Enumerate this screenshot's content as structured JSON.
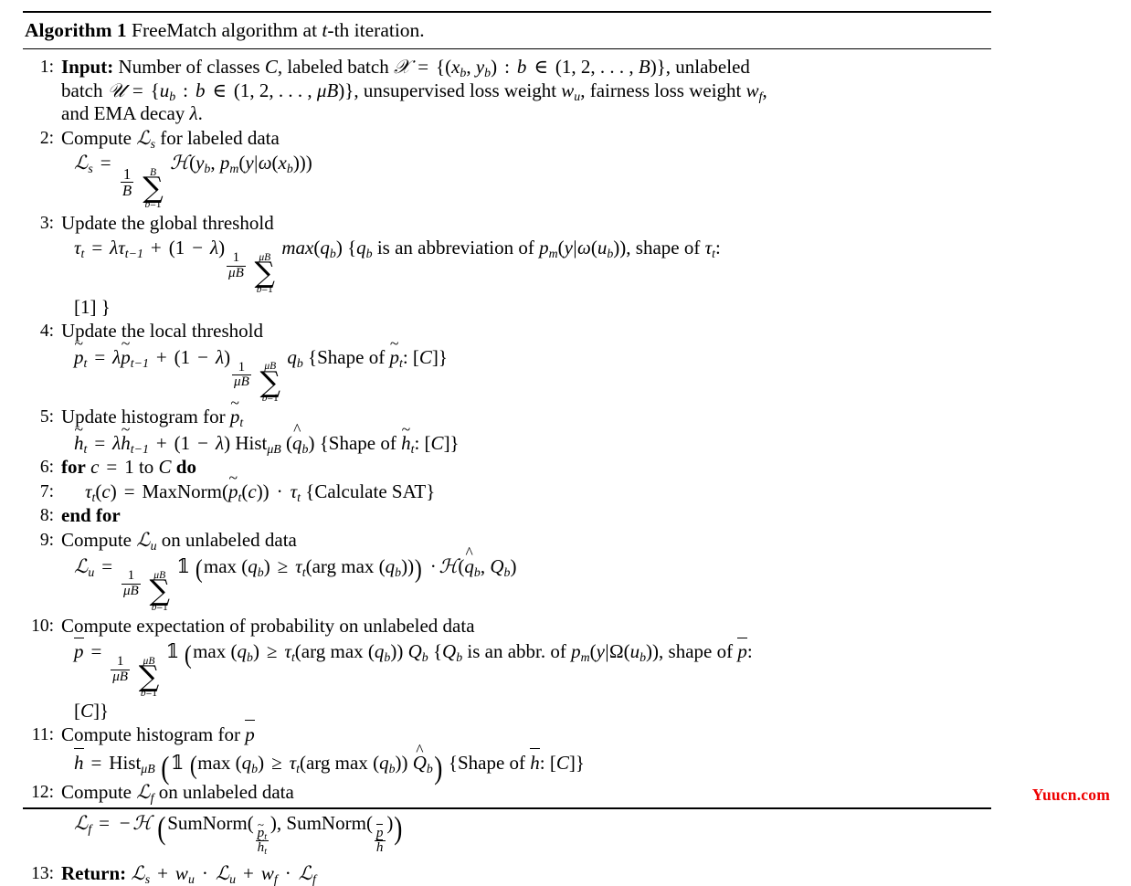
{
  "document": {
    "type": "algorithm-pseudocode",
    "title_prefix": "Algorithm 1",
    "title_rest": " FreeMatch algorithm at ",
    "title_var": "t",
    "title_suffix": "-th iteration.",
    "watermark": "Yuucn.com"
  },
  "algorithm": {
    "name": "FreeMatch",
    "iteration_variable": "t",
    "lines": [
      {
        "number": "1:",
        "keyword": "Input:",
        "text": "Number of classes C, labeled batch X = {(x_b, y_b) : b ∈ (1, 2, …, B)}, unlabeled batch U = {u_b : b ∈ (1, 2, …, μB)}, unsupervised loss weight w_u, fairness loss weight w_f, and EMA decay λ."
      },
      {
        "number": "2:",
        "text": "Compute L_s for labeled data",
        "formula": "L_s = (1/B) Σ_{b=1}^{B} H(y_b, p_m(y|ω(x_b)))"
      },
      {
        "number": "3:",
        "text": "Update the global threshold",
        "formula": "τ_t = λτ_{t-1} + (1 - λ)(1/μB) Σ_{b=1}^{μB} max(q_b) {q_b is an abbreviation of p_m(y|ω(u_b)), shape of τ_t: [1] }"
      },
      {
        "number": "4:",
        "text": "Update the local threshold",
        "formula": "p̃_t = λp̃_{t-1} + (1 - λ)(1/μB) Σ_{b=1}^{μB} q_b {Shape of p̃_t: [C]}"
      },
      {
        "number": "5:",
        "text": "Update histogram for p̃_t",
        "formula": "h̃_t = λh̃_{t-1} + (1 - λ) Hist_{μB}(q̂_b) {Shape of h̃_t: [C]}"
      },
      {
        "number": "6:",
        "keyword": "for",
        "text": "for c = 1 to C do"
      },
      {
        "number": "7:",
        "text": "τ_t(c) = MaxNorm(p̃_t(c)) · τ_t {Calculate SAT}"
      },
      {
        "number": "8:",
        "keyword": "end for",
        "text": "end for"
      },
      {
        "number": "9:",
        "text": "Compute L_u on unlabeled data",
        "formula": "L_u = (1/μB) Σ_{b=1}^{μB} 1(max(q_b) ≥ τ_t(arg max(q_b))) · H(q̂_b, Q_b)"
      },
      {
        "number": "10:",
        "text": "Compute expectation of probability on unlabeled data",
        "formula": "p̄ = (1/μB) Σ_{b=1}^{μB} 1(max(q_b) ≥ τ_t(arg max(q_b)) Q_b {Q_b is an abbr. of p_m(y|Ω(u_b)), shape of p̄: [C]}"
      },
      {
        "number": "11:",
        "text": "Compute histogram for p̄",
        "formula": "h̄ = Hist_{μB}(1(max(q_b) ≥ τ_t(arg max(q_b)) Q̂_b) {Shape of h̄: [C]}"
      },
      {
        "number": "12:",
        "text": "Compute L_f on unlabeled data",
        "formula": "L_f = -H(SumNorm(p̃_t/h̃_t), SumNorm(p̄/h̄))"
      },
      {
        "number": "13:",
        "keyword": "Return:",
        "text": "Return: L_s + w_u · L_u + w_f · L_f"
      }
    ]
  },
  "labels": {
    "line1_keyword": "Input:",
    "line1_a": "Number of classes ",
    "line1_b": ", labeled batch ",
    "line1_c": ", unlabeled",
    "line1_d": "batch ",
    "line1_e": ", unsupervised loss weight ",
    "line1_f": ", fairness loss weight ",
    "line1_g": "and EMA decay ",
    "line2_text_a": "Compute ",
    "line2_text_b": " for labeled data",
    "line3_text": "Update the global threshold",
    "line3_note_a": " is an abbreviation of ",
    "line3_note_b": ", shape of ",
    "line3_note_c": "[1] }",
    "line4_text": "Update the local threshold",
    "line4_note": "{Shape of ",
    "line5_text_a": "Update histogram for ",
    "line5_note": "{Shape of ",
    "line6_for": "for",
    "line6_mid": " to ",
    "line6_do": "do",
    "line7_note": "{Calculate SAT}",
    "line8_endfor": "end for",
    "line9_text_a": "Compute ",
    "line9_text_b": " on unlabeled data",
    "line10_text": "Compute expectation of probability on unlabeled data",
    "line10_note_a": " is an abbr. of ",
    "line10_note_b": ", shape of ",
    "line10_note_c": "[C]}",
    "line11_text_a": "Compute histogram for ",
    "line11_note": "{Shape of ",
    "line12_text_a": "Compute ",
    "line12_text_b": " on unlabeled data",
    "line13_return": "Return:",
    "bracket_C": "[C]}",
    "colon": ":",
    "hist": "Hist",
    "maxnorm": "MaxNorm",
    "sumnorm": "SumNorm",
    "max": "max",
    "argmax": "arg max",
    "shape_of": "Shape of "
  }
}
